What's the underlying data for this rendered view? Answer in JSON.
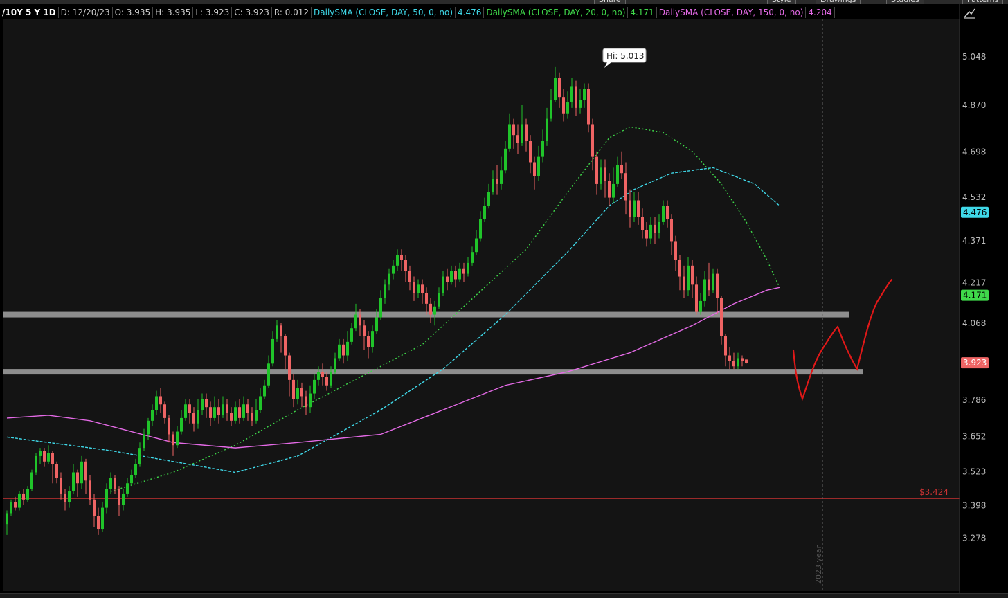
{
  "toolbar": {
    "buttons": [
      "Share",
      "Style",
      "Drawings",
      "Studies",
      "Patterns"
    ]
  },
  "header": {
    "symbol": "/10Y 5 Y 1D",
    "date": "D: 12/20/23",
    "open": "O: 3.935",
    "high": "H: 3.935",
    "low": "L: 3.923",
    "close": "C: 3.923",
    "range": "R: 0.012",
    "sma50_label": "DailySMA (CLOSE, DAY, 50, 0, no)",
    "sma50_value": "4.476",
    "sma20_label": "DailySMA (CLOSE, DAY, 20, 0, no)",
    "sma20_value": "4.171",
    "sma150_label": "DailySMA (CLOSE, DAY, 150, 0, no)",
    "sma150_value": "4.204"
  },
  "colors": {
    "background": "#141414",
    "up": "#20c42a",
    "down": "#ef6464",
    "sma50": "#3fd8e8",
    "sma20": "#3fd84a",
    "sma150": "#e46ae6",
    "support": "#8e8e8e",
    "drawing": "#e01818",
    "ref_line": "#c83232"
  },
  "chart_data": {
    "type": "candlestick",
    "title": "/10Y 5 Y 1D",
    "ylim": [
      3.21,
      5.12
    ],
    "y_ticks": [
      5.048,
      4.87,
      4.698,
      4.532,
      4.371,
      4.217,
      4.068,
      3.786,
      3.652,
      3.523,
      3.398,
      3.278
    ],
    "price_tags": [
      {
        "label": "4.476",
        "value": 4.476,
        "color": "#3fd8e8"
      },
      {
        "label": "4.171",
        "value": 4.171,
        "color": "#3fd84a"
      },
      {
        "label": "3.923",
        "value": 3.923,
        "color": "#ef6464"
      }
    ],
    "high_marker": {
      "label": "Hi: 5.013",
      "value": 5.013
    },
    "reference_line": {
      "label": "$3.424",
      "value": 3.424
    },
    "year_marker": {
      "label": "2023 year"
    },
    "support_levels": [
      4.1,
      3.89
    ],
    "candles": [
      [
        3.33,
        3.37,
        3.29,
        3.38
      ],
      [
        3.37,
        3.41,
        3.36,
        3.42
      ],
      [
        3.41,
        3.39,
        3.38,
        3.43
      ],
      [
        3.39,
        3.44,
        3.38,
        3.45
      ],
      [
        3.44,
        3.42,
        3.4,
        3.46
      ],
      [
        3.42,
        3.46,
        3.41,
        3.47
      ],
      [
        3.46,
        3.52,
        3.45,
        3.53
      ],
      [
        3.52,
        3.58,
        3.51,
        3.59
      ],
      [
        3.58,
        3.6,
        3.55,
        3.61
      ],
      [
        3.6,
        3.56,
        3.54,
        3.61
      ],
      [
        3.56,
        3.59,
        3.55,
        3.62
      ],
      [
        3.59,
        3.55,
        3.48,
        3.6
      ],
      [
        3.55,
        3.5,
        3.48,
        3.56
      ],
      [
        3.5,
        3.44,
        3.42,
        3.52
      ],
      [
        3.44,
        3.41,
        3.38,
        3.46
      ],
      [
        3.41,
        3.45,
        3.39,
        3.47
      ],
      [
        3.45,
        3.52,
        3.44,
        3.55
      ],
      [
        3.52,
        3.48,
        3.43,
        3.53
      ],
      [
        3.48,
        3.56,
        3.46,
        3.58
      ],
      [
        3.56,
        3.49,
        3.44,
        3.57
      ],
      [
        3.49,
        3.42,
        3.4,
        3.51
      ],
      [
        3.42,
        3.36,
        3.32,
        3.44
      ],
      [
        3.36,
        3.31,
        3.29,
        3.39
      ],
      [
        3.31,
        3.39,
        3.3,
        3.41
      ],
      [
        3.39,
        3.46,
        3.37,
        3.48
      ],
      [
        3.46,
        3.5,
        3.44,
        3.52
      ],
      [
        3.5,
        3.46,
        3.44,
        3.51
      ],
      [
        3.46,
        3.4,
        3.36,
        3.47
      ],
      [
        3.4,
        3.44,
        3.38,
        3.46
      ],
      [
        3.44,
        3.48,
        3.43,
        3.5
      ],
      [
        3.48,
        3.51,
        3.47,
        3.53
      ],
      [
        3.51,
        3.55,
        3.5,
        3.57
      ],
      [
        3.55,
        3.61,
        3.54,
        3.63
      ],
      [
        3.61,
        3.66,
        3.6,
        3.68
      ],
      [
        3.66,
        3.71,
        3.64,
        3.72
      ],
      [
        3.71,
        3.75,
        3.69,
        3.77
      ],
      [
        3.75,
        3.8,
        3.73,
        3.82
      ],
      [
        3.8,
        3.77,
        3.74,
        3.83
      ],
      [
        3.77,
        3.72,
        3.7,
        3.78
      ],
      [
        3.72,
        3.66,
        3.63,
        3.73
      ],
      [
        3.66,
        3.62,
        3.58,
        3.67
      ],
      [
        3.62,
        3.67,
        3.61,
        3.69
      ],
      [
        3.67,
        3.72,
        3.66,
        3.75
      ],
      [
        3.72,
        3.77,
        3.71,
        3.79
      ],
      [
        3.77,
        3.74,
        3.7,
        3.79
      ],
      [
        3.74,
        3.7,
        3.67,
        3.76
      ],
      [
        3.7,
        3.75,
        3.68,
        3.79
      ],
      [
        3.75,
        3.79,
        3.73,
        3.81
      ],
      [
        3.79,
        3.76,
        3.72,
        3.81
      ],
      [
        3.76,
        3.72,
        3.69,
        3.78
      ],
      [
        3.72,
        3.76,
        3.71,
        3.8
      ],
      [
        3.76,
        3.73,
        3.7,
        3.79
      ],
      [
        3.73,
        3.77,
        3.72,
        3.8
      ],
      [
        3.77,
        3.74,
        3.71,
        3.79
      ],
      [
        3.74,
        3.71,
        3.69,
        3.76
      ],
      [
        3.71,
        3.76,
        3.7,
        3.78
      ],
      [
        3.76,
        3.72,
        3.7,
        3.79
      ],
      [
        3.72,
        3.77,
        3.71,
        3.8
      ],
      [
        3.77,
        3.74,
        3.71,
        3.79
      ],
      [
        3.74,
        3.71,
        3.69,
        3.76
      ],
      [
        3.71,
        3.75,
        3.7,
        3.79
      ],
      [
        3.75,
        3.8,
        3.74,
        3.83
      ],
      [
        3.8,
        3.84,
        3.79,
        3.86
      ],
      [
        3.84,
        3.92,
        3.83,
        3.95
      ],
      [
        3.92,
        4.01,
        3.91,
        4.04
      ],
      [
        4.01,
        4.06,
        4.0,
        4.08
      ],
      [
        4.06,
        4.02,
        3.96,
        4.07
      ],
      [
        4.02,
        3.95,
        3.9,
        4.03
      ],
      [
        3.95,
        3.86,
        3.8,
        3.96
      ],
      [
        3.86,
        3.79,
        3.76,
        3.88
      ],
      [
        3.79,
        3.83,
        3.77,
        3.86
      ],
      [
        3.83,
        3.8,
        3.76,
        3.85
      ],
      [
        3.8,
        3.76,
        3.73,
        3.82
      ],
      [
        3.76,
        3.81,
        3.74,
        3.84
      ],
      [
        3.81,
        3.86,
        3.79,
        3.88
      ],
      [
        3.86,
        3.89,
        3.84,
        3.91
      ],
      [
        3.89,
        3.87,
        3.84,
        3.92
      ],
      [
        3.87,
        3.84,
        3.82,
        3.89
      ],
      [
        3.84,
        3.89,
        3.83,
        3.91
      ],
      [
        3.89,
        3.94,
        3.88,
        3.96
      ],
      [
        3.94,
        3.99,
        3.93,
        4.01
      ],
      [
        3.99,
        3.95,
        3.92,
        4.01
      ],
      [
        3.95,
        4.0,
        3.93,
        4.04
      ],
      [
        4.0,
        4.05,
        3.99,
        4.07
      ],
      [
        4.05,
        4.1,
        4.04,
        4.14
      ],
      [
        4.1,
        4.06,
        4.02,
        4.12
      ],
      [
        4.06,
        4.02,
        3.97,
        4.08
      ],
      [
        4.02,
        3.98,
        3.94,
        4.04
      ],
      [
        3.98,
        4.04,
        3.96,
        4.06
      ],
      [
        4.04,
        4.09,
        4.03,
        4.12
      ],
      [
        4.09,
        4.16,
        4.08,
        4.19
      ],
      [
        4.16,
        4.21,
        4.14,
        4.23
      ],
      [
        4.21,
        4.25,
        4.19,
        4.27
      ],
      [
        4.25,
        4.28,
        4.23,
        4.3
      ],
      [
        4.28,
        4.32,
        4.26,
        4.34
      ],
      [
        4.32,
        4.3,
        4.26,
        4.34
      ],
      [
        4.3,
        4.26,
        4.22,
        4.32
      ],
      [
        4.26,
        4.22,
        4.19,
        4.28
      ],
      [
        4.22,
        4.18,
        4.15,
        4.24
      ],
      [
        4.18,
        4.21,
        4.16,
        4.23
      ],
      [
        4.21,
        4.18,
        4.14,
        4.23
      ],
      [
        4.18,
        4.14,
        4.1,
        4.2
      ],
      [
        4.14,
        4.1,
        4.07,
        4.16
      ],
      [
        4.1,
        4.13,
        4.06,
        4.15
      ],
      [
        4.13,
        4.18,
        4.12,
        4.2
      ],
      [
        4.18,
        4.24,
        4.17,
        4.26
      ],
      [
        4.24,
        4.22,
        4.19,
        4.27
      ],
      [
        4.22,
        4.26,
        4.21,
        4.28
      ],
      [
        4.26,
        4.23,
        4.2,
        4.28
      ],
      [
        4.23,
        4.27,
        4.22,
        4.29
      ],
      [
        4.27,
        4.25,
        4.22,
        4.29
      ],
      [
        4.25,
        4.29,
        4.24,
        4.31
      ],
      [
        4.29,
        4.33,
        4.28,
        4.35
      ],
      [
        4.33,
        4.38,
        4.32,
        4.41
      ],
      [
        4.38,
        4.45,
        4.37,
        4.48
      ],
      [
        4.45,
        4.5,
        4.44,
        4.53
      ],
      [
        4.5,
        4.55,
        4.49,
        4.58
      ],
      [
        4.55,
        4.6,
        4.54,
        4.63
      ],
      [
        4.6,
        4.58,
        4.54,
        4.65
      ],
      [
        4.58,
        4.63,
        4.56,
        4.68
      ],
      [
        4.63,
        4.71,
        4.62,
        4.74
      ],
      [
        4.71,
        4.8,
        4.7,
        4.84
      ],
      [
        4.8,
        4.76,
        4.71,
        4.82
      ],
      [
        4.76,
        4.73,
        4.69,
        4.8
      ],
      [
        4.73,
        4.8,
        4.72,
        4.87
      ],
      [
        4.8,
        4.74,
        4.7,
        4.82
      ],
      [
        4.74,
        4.66,
        4.62,
        4.76
      ],
      [
        4.66,
        4.61,
        4.56,
        4.68
      ],
      [
        4.61,
        4.68,
        4.59,
        4.72
      ],
      [
        4.68,
        4.74,
        4.66,
        4.78
      ],
      [
        4.74,
        4.82,
        4.72,
        4.86
      ],
      [
        4.82,
        4.89,
        4.81,
        4.93
      ],
      [
        4.89,
        4.97,
        4.88,
        5.01
      ],
      [
        4.97,
        4.9,
        4.86,
        4.99
      ],
      [
        4.9,
        4.84,
        4.81,
        4.93
      ],
      [
        4.84,
        4.88,
        4.82,
        4.92
      ],
      [
        4.88,
        4.94,
        4.86,
        4.97
      ],
      [
        4.94,
        4.86,
        4.83,
        4.96
      ],
      [
        4.86,
        4.89,
        4.84,
        4.93
      ],
      [
        4.89,
        4.93,
        4.86,
        4.95
      ],
      [
        4.93,
        4.8,
        4.77,
        4.95
      ],
      [
        4.8,
        4.68,
        4.63,
        4.82
      ],
      [
        4.68,
        4.58,
        4.54,
        4.7
      ],
      [
        4.58,
        4.64,
        4.56,
        4.67
      ],
      [
        4.64,
        4.59,
        4.53,
        4.67
      ],
      [
        4.59,
        4.53,
        4.5,
        4.62
      ],
      [
        4.53,
        4.58,
        4.51,
        4.64
      ],
      [
        4.58,
        4.65,
        4.57,
        4.68
      ],
      [
        4.65,
        4.62,
        4.6,
        4.7
      ],
      [
        4.62,
        4.52,
        4.47,
        4.66
      ],
      [
        4.52,
        4.46,
        4.42,
        4.56
      ],
      [
        4.46,
        4.52,
        4.44,
        4.55
      ],
      [
        4.52,
        4.46,
        4.43,
        4.55
      ],
      [
        4.46,
        4.41,
        4.38,
        4.49
      ],
      [
        4.41,
        4.38,
        4.35,
        4.44
      ],
      [
        4.38,
        4.43,
        4.36,
        4.46
      ],
      [
        4.43,
        4.4,
        4.36,
        4.46
      ],
      [
        4.4,
        4.44,
        4.38,
        4.47
      ],
      [
        4.44,
        4.5,
        4.43,
        4.52
      ],
      [
        4.5,
        4.45,
        4.42,
        4.52
      ],
      [
        4.45,
        4.37,
        4.32,
        4.47
      ],
      [
        4.37,
        4.3,
        4.26,
        4.39
      ],
      [
        4.3,
        4.24,
        4.19,
        4.32
      ],
      [
        4.24,
        4.19,
        4.16,
        4.28
      ],
      [
        4.19,
        4.28,
        4.17,
        4.31
      ],
      [
        4.28,
        4.21,
        4.16,
        4.3
      ],
      [
        4.21,
        4.11,
        4.1,
        4.24
      ],
      [
        4.11,
        4.15,
        4.1,
        4.18
      ],
      [
        4.15,
        4.23,
        4.13,
        4.26
      ],
      [
        4.23,
        4.19,
        4.17,
        4.29
      ],
      [
        4.19,
        4.25,
        4.18,
        4.27
      ],
      [
        4.25,
        4.16,
        4.1,
        4.27
      ],
      [
        4.16,
        4.02,
        3.99,
        4.17
      ],
      [
        4.02,
        3.95,
        3.91,
        4.03
      ],
      [
        3.95,
        3.93,
        3.9,
        3.98
      ],
      [
        3.93,
        3.91,
        3.9,
        3.96
      ],
      [
        3.91,
        3.94,
        3.9,
        3.96
      ],
      [
        3.94,
        3.93,
        3.91,
        3.95
      ],
      [
        3.935,
        3.923,
        3.92,
        3.935
      ]
    ],
    "series": [
      {
        "name": "DailySMA (CLOSE, DAY, 50, 0, no)",
        "values": [
          [
            0,
            3.65
          ],
          [
            25,
            3.6
          ],
          [
            40,
            3.56
          ],
          [
            55,
            3.52
          ],
          [
            70,
            3.58
          ],
          [
            90,
            3.75
          ],
          [
            105,
            3.9
          ],
          [
            120,
            4.1
          ],
          [
            135,
            4.33
          ],
          [
            145,
            4.5
          ],
          [
            151,
            4.56
          ],
          [
            160,
            4.62
          ],
          [
            170,
            4.64
          ],
          [
            180,
            4.58
          ],
          [
            186,
            4.5
          ]
        ]
      },
      {
        "name": "DailySMA (CLOSE, DAY, 20, 0, no)",
        "values": [
          [
            25,
            3.45
          ],
          [
            40,
            3.52
          ],
          [
            55,
            3.62
          ],
          [
            70,
            3.75
          ],
          [
            85,
            3.87
          ],
          [
            100,
            3.99
          ],
          [
            115,
            4.2
          ],
          [
            125,
            4.34
          ],
          [
            135,
            4.55
          ],
          [
            145,
            4.75
          ],
          [
            150,
            4.79
          ],
          [
            158,
            4.77
          ],
          [
            165,
            4.7
          ],
          [
            172,
            4.58
          ],
          [
            178,
            4.44
          ],
          [
            183,
            4.3
          ],
          [
            186,
            4.2
          ]
        ]
      },
      {
        "name": "DailySMA (CLOSE, DAY, 150, 0, no)",
        "values": [
          [
            0,
            3.72
          ],
          [
            10,
            3.73
          ],
          [
            20,
            3.71
          ],
          [
            30,
            3.67
          ],
          [
            40,
            3.63
          ],
          [
            55,
            3.61
          ],
          [
            70,
            3.63
          ],
          [
            90,
            3.66
          ],
          [
            105,
            3.75
          ],
          [
            120,
            3.84
          ],
          [
            135,
            3.89
          ],
          [
            150,
            3.96
          ],
          [
            165,
            4.06
          ],
          [
            175,
            4.14
          ],
          [
            183,
            4.19
          ],
          [
            186,
            4.2
          ]
        ]
      }
    ]
  }
}
